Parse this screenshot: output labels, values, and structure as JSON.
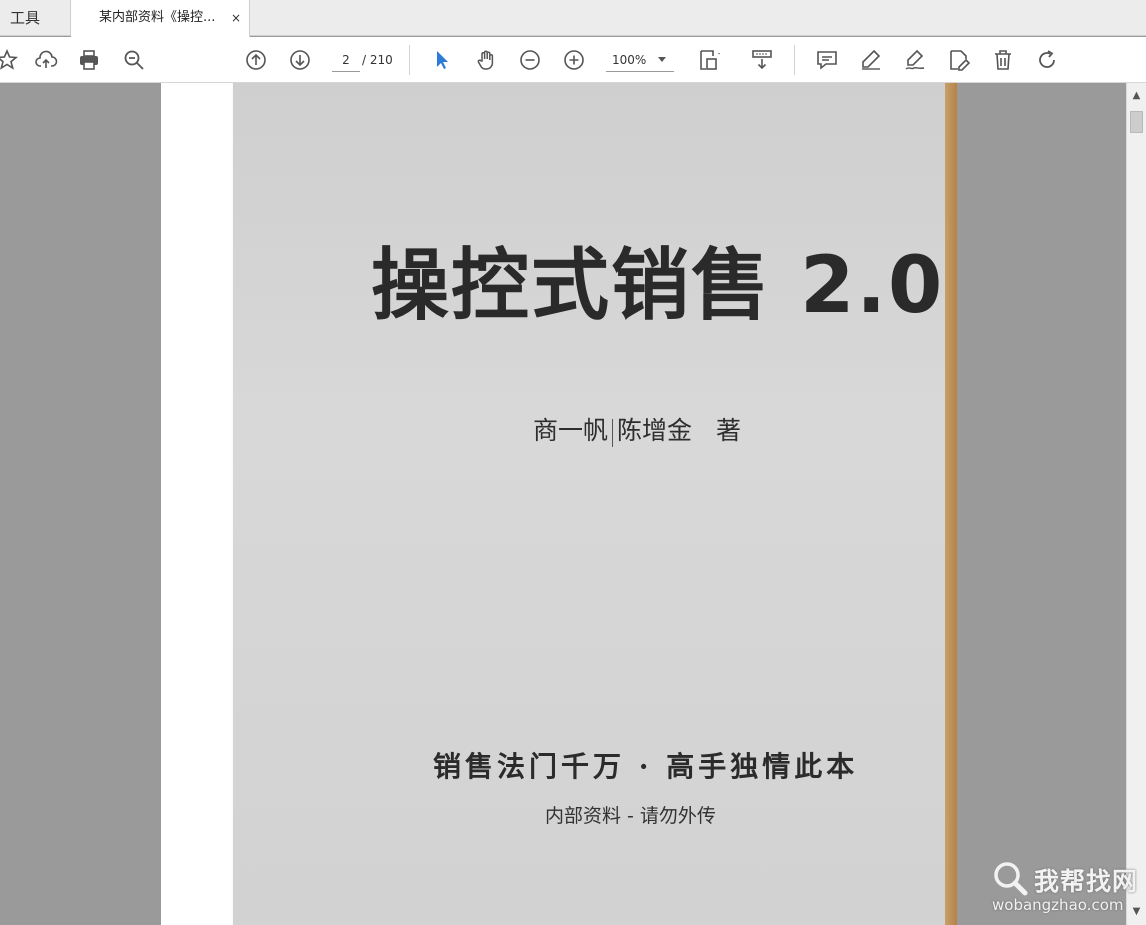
{
  "tabs": {
    "tools_label": "工具",
    "document_label": "某内部资料《操控...",
    "close_glyph": "×"
  },
  "toolbar": {
    "current_page": "2",
    "total_pages": "/ 210",
    "zoom": "100%",
    "icons": [
      "star-icon",
      "cloud-upload-icon",
      "print-icon",
      "zoom-out-search-icon",
      "page-up-icon",
      "page-down-icon",
      "select-arrow-icon",
      "hand-icon",
      "zoom-minus-icon",
      "zoom-plus-icon",
      "fit-page-icon",
      "scroll-mode-icon",
      "comment-icon",
      "highlight-icon",
      "sign-icon",
      "share-edit-icon",
      "trash-icon",
      "rotate-icon"
    ],
    "accent": "#2d7bd8"
  },
  "document": {
    "title": "操控式销售 2.0",
    "author_1": "商一帆",
    "author_2": "陈增金",
    "author_suffix": "著",
    "slogan": "销售法门千万 · 高手独情此本",
    "internal_notice": "内部资料   -   请勿外传"
  },
  "watermark": {
    "brand": "我帮找网",
    "url": "wobangzhao.com"
  },
  "scrollbar": {
    "up_glyph": "▲",
    "down_glyph": "▼"
  }
}
